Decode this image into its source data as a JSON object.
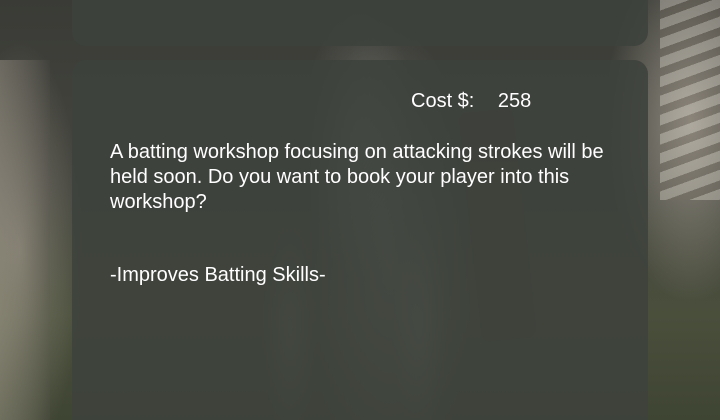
{
  "workshop": {
    "cost_label": "Cost $:",
    "cost_value": "258",
    "description": "A batting workshop focusing on attacking strokes will be held soon. Do you want to book your player into this workshop?",
    "benefit": "-Improves Batting Skills-"
  }
}
